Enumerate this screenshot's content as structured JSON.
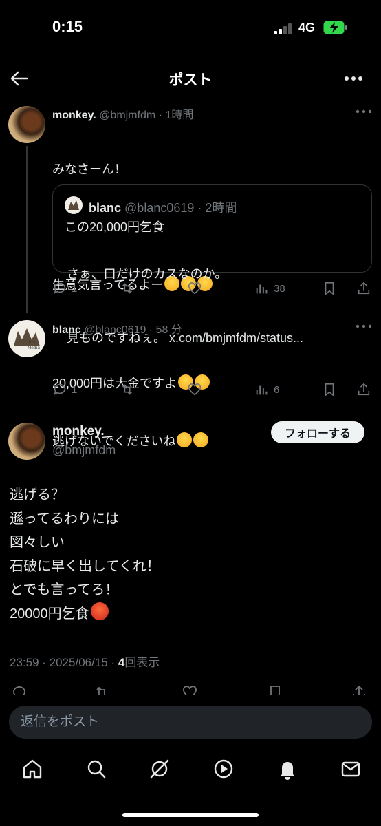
{
  "status_bar": {
    "time": "0:15",
    "network": "4G",
    "battery_color": "#32d74b"
  },
  "header": {
    "title": "ポスト"
  },
  "tweets": [
    {
      "display_name": "monkey.",
      "handle": "@bmjmfdm",
      "time_ago": "1時間",
      "lines": [
        "みなさーん！",
        "　この20,000円乞食",
        "生意気言ってるよー"
      ],
      "line_emojis": [
        "",
        "",
        "rolling-laugh rolling-laugh rolling-laugh"
      ],
      "quote": {
        "display_name": "blanc",
        "handle": "@blanc0619",
        "time_ago": "2時間",
        "lines": [
          "さぁ、口だけのカスなのか。",
          "見ものですねぇ。 x.com/bmjmfdm/status..."
        ]
      },
      "actions": {
        "replies": "1",
        "retweets": "",
        "likes": "",
        "views": "38"
      }
    },
    {
      "display_name": "blanc",
      "handle": "@blanc0619",
      "time_ago": "58 分",
      "lines": [
        "20,000円は大金ですよ",
        "逃げないでくださいね"
      ],
      "actions": {
        "replies": "1",
        "retweets": "",
        "likes": "",
        "views": "6"
      }
    }
  ],
  "main_post": {
    "display_name": "monkey.",
    "handle": "@bmjmfdm",
    "follow_label": "フォローする",
    "lines": [
      "逃げる？",
      "遜ってるわりには",
      "図々しい",
      "石破に早く出してくれ！",
      "とでも言ってろ！",
      "20000円乞食"
    ],
    "timestamp": "23:59 · 2025/06/15 · ",
    "views_count": "4",
    "views_label": "回表示"
  },
  "reply_bar": {
    "placeholder": "返信をポスト"
  },
  "bottom_nav": [
    "home-icon",
    "search-icon",
    "grok-icon",
    "video-icon",
    "notifications-icon",
    "messages-icon"
  ]
}
